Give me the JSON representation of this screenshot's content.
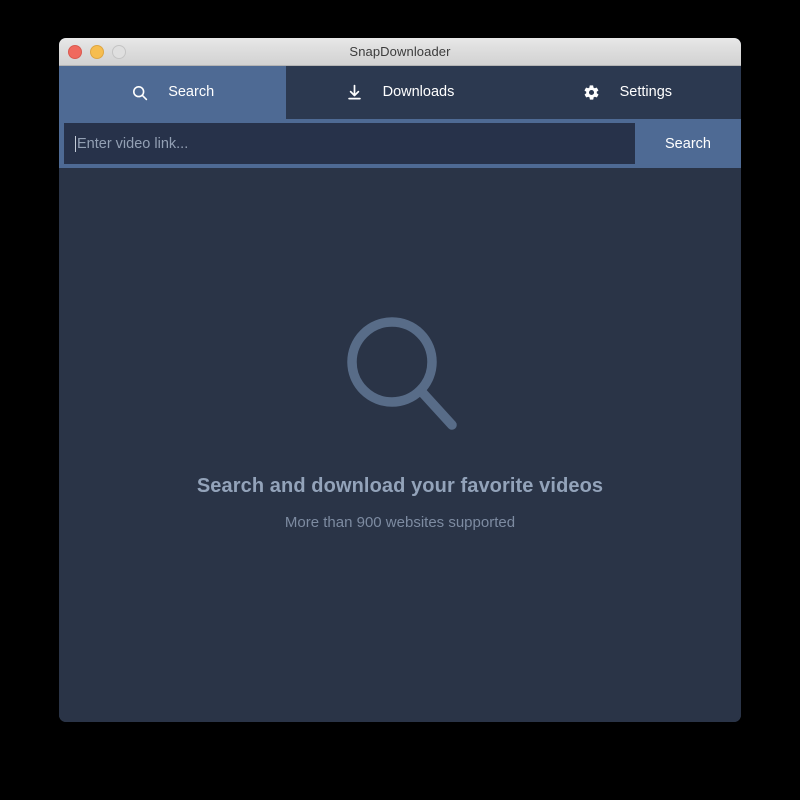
{
  "window": {
    "title": "SnapDownloader",
    "controls": [
      {
        "name": "close",
        "color": "#f0695e"
      },
      {
        "name": "minimize",
        "color": "#f6bd4f"
      },
      {
        "name": "zoom",
        "color": "#dfdfdf"
      }
    ]
  },
  "tabs": [
    {
      "id": "search",
      "label": "Search",
      "icon": "search-icon",
      "active": true
    },
    {
      "id": "downloads",
      "label": "Downloads",
      "icon": "download-icon",
      "active": false
    },
    {
      "id": "settings",
      "label": "Settings",
      "icon": "gear-icon",
      "active": false
    }
  ],
  "search": {
    "placeholder": "Enter video link...",
    "value": "",
    "button_label": "Search"
  },
  "empty_state": {
    "icon": "search-icon",
    "title": "Search and download your favorite videos",
    "subtitle": "More than 900 websites supported"
  },
  "colors": {
    "accent": "#4e6a94",
    "tab_bar": "#2c3950",
    "content_bg": "#2a3447",
    "input_bg": "#27324a",
    "empty_icon": "#586c88",
    "empty_title": "#93a3ba",
    "empty_subtitle": "#7d8ba1"
  }
}
